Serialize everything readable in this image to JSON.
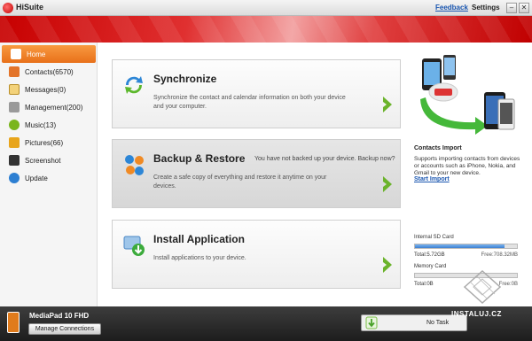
{
  "window": {
    "title": "HiSuite",
    "feedback_label": "Feedback",
    "settings_label": "Settings",
    "minimize_glyph": "–",
    "close_glyph": "✕"
  },
  "sidebar": {
    "items": [
      {
        "label": "Home",
        "icon": "home-icon",
        "active": true
      },
      {
        "label": "Contacts(6570)",
        "icon": "contacts-icon"
      },
      {
        "label": "Messages(0)",
        "icon": "messages-icon"
      },
      {
        "label": "Management(200)",
        "icon": "management-icon"
      },
      {
        "label": "Music(13)",
        "icon": "music-icon"
      },
      {
        "label": "Pictures(66)",
        "icon": "pictures-icon"
      },
      {
        "label": "Screenshot",
        "icon": "screenshot-icon"
      },
      {
        "label": "Update",
        "icon": "update-icon"
      }
    ]
  },
  "cards": {
    "sync": {
      "title": "Synchronize",
      "desc": "Synchronize the contact and calendar information on both your device and your computer."
    },
    "backup": {
      "title": "Backup & Restore",
      "note": "You have not backed up your device. Backup now?",
      "desc": "Create a safe copy of everything and restore it anytime on your devices."
    },
    "install": {
      "title": "Install Application",
      "desc": "Install applications to your device."
    }
  },
  "promo": {
    "title": "Contacts Import",
    "text": "Supports importing contacts from devices or accounts such as iPhone, Nokia, and Gmail to your new device.",
    "link": "Start Import"
  },
  "storage": {
    "sd": {
      "label": "Internal SD Card",
      "total": "Total:5.72GB",
      "free": "Free:708.32MB",
      "used_fraction": 0.88
    },
    "memory": {
      "label": "Memory Card",
      "total": "Total:0B",
      "free": "Free:0B",
      "used_fraction": 0.0
    }
  },
  "device": {
    "name": "MediaPad 10 FHD",
    "manage_label": "Manage Connections"
  },
  "task": {
    "label": "No Task"
  },
  "watermark": {
    "text": "INSTALUJ.CZ"
  }
}
